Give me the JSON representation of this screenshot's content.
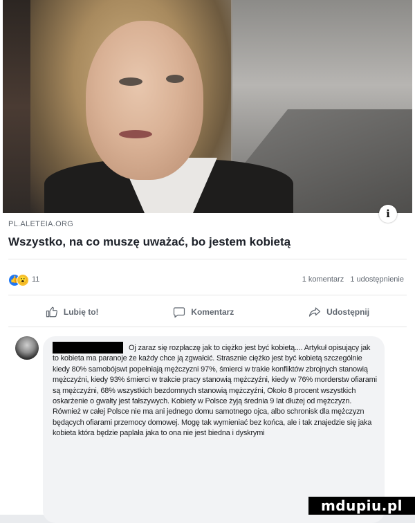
{
  "link_preview": {
    "domain": "PL.ALETEIA.ORG",
    "title": "Wszystko, na co muszę uważać, bo jestem kobietą"
  },
  "reactions": {
    "count": "11",
    "comments": "1 komentarz",
    "shares": "1 udostępnienie"
  },
  "actions": {
    "like": "Lubię to!",
    "comment": "Komentarz",
    "share": "Udostępnij"
  },
  "comment": {
    "text": "Oj zaraz się rozpłaczę jak to ciężko jest być kobietą.... Artykuł opisujący jak to kobieta ma paranoje że każdy chce ją zgwałcić. Strasznie ciężko jest być kobietą szczególnie kiedy 80% samobójswt popełniają mężczyzni 97%, śmierci w trakie konfliktów zbrojnych stanowią mężczyźni, kiedy 93% śmierci w trakcie pracy stanowią mężczyźni, kiedy w 76% morderstw ofiarami są mężczyźni, 68% wszystkich bezdomnych stanowią mężczyźni, Około 8 procent wszystkich oskarżenie o gwałty jest fałszywych. Kobiety w Polsce żyją średnia 9 lat dłużej od mężczyzn. Również w całej Polsce nie ma ani jednego domu samotnego ojca, albo schronisk dla mężczyzn będących ofiarami przemocy domowej. Mogę tak wymieniać bez końca, ale i tak znajedzie się jaka kobieta która będzie paplała jaka to ona nie jest biedna i dyskrymi"
  },
  "watermark": {
    "text": "mdupiu.pl"
  }
}
